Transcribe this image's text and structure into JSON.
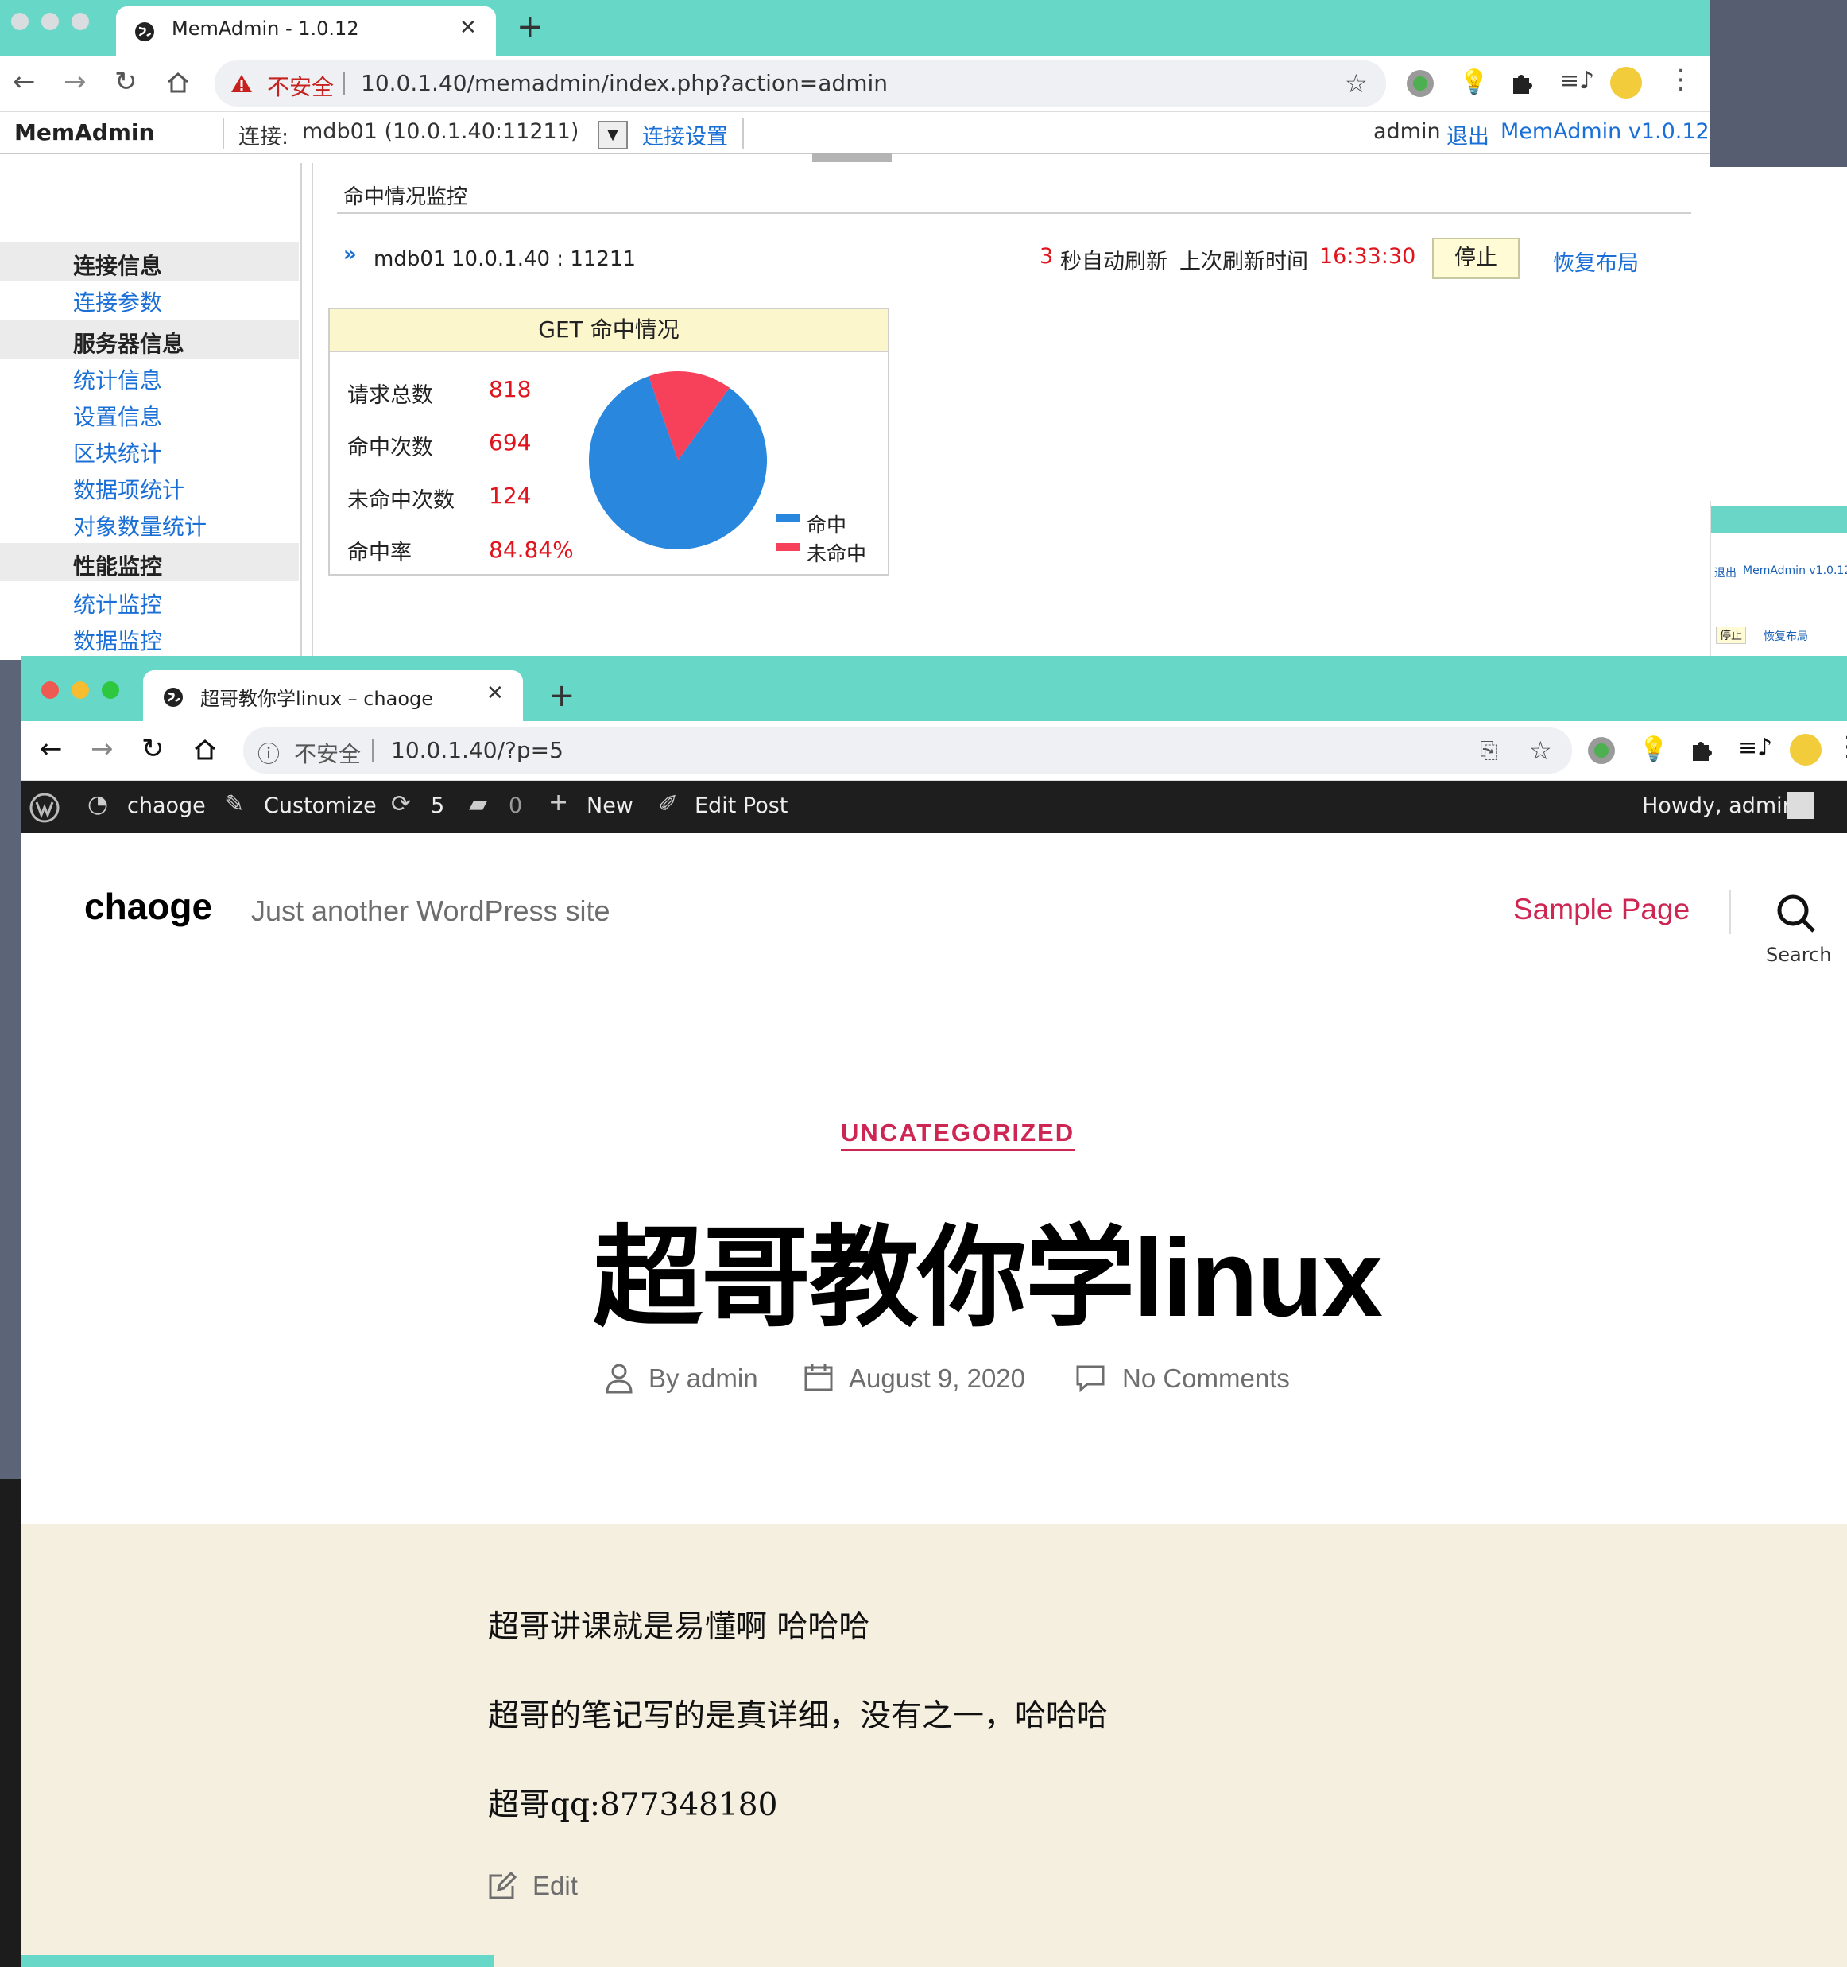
{
  "window1": {
    "tab_title": "MemAdmin - 1.0.12",
    "security_label": "不安全",
    "url": "10.0.1.40/memadmin/index.php?action=admin",
    "app": {
      "logo": "MemAdmin",
      "connect_label": "连接:",
      "connection_value": "mdb01 (10.0.1.40:11211)",
      "connect_settings": "连接设置",
      "user": "admin",
      "logout": "退出",
      "version": "MemAdmin v1.0.12"
    },
    "sidebar": {
      "sections": [
        {
          "header": "连接信息",
          "items": [
            "连接参数"
          ]
        },
        {
          "header": "服务器信息",
          "items": [
            "统计信息",
            "设置信息",
            "区块统计",
            "数据项统计",
            "对象数量统计"
          ]
        },
        {
          "header": "性能监控",
          "items": [
            "统计监控",
            "数据监控"
          ]
        }
      ]
    },
    "main": {
      "heading": "命中情况监控",
      "server_name": "mdb01",
      "server_addr": "10.0.1.40 : 11211",
      "refresh_seconds": "3",
      "refresh_label": "秒自动刷新",
      "last_refresh_label": "上次刷新时间",
      "last_refresh_time": "16:33:30",
      "stop_button": "停止",
      "restore_layout": "恢复布局",
      "get_box": {
        "title": "GET 命中情况",
        "rows": [
          {
            "label": "请求总数",
            "value": "818"
          },
          {
            "label": "命中次数",
            "value": "694"
          },
          {
            "label": "未命中次数",
            "value": "124"
          },
          {
            "label": "命中率",
            "value": "84.84%"
          }
        ],
        "legend": [
          {
            "name": "命中",
            "color": "#2a87de"
          },
          {
            "name": "未命中",
            "color": "#f7405a"
          }
        ]
      }
    }
  },
  "chart_data": {
    "type": "pie",
    "labels": [
      "命中",
      "未命中"
    ],
    "values": [
      694,
      124
    ],
    "colors": [
      "#2a87de",
      "#f7405a"
    ],
    "legend": "bottom-right"
  },
  "background_window": {
    "logout": "退出",
    "version": "MemAdmin v1.0.12",
    "stop_button": "停止",
    "restore_layout": "恢复布局"
  },
  "window2": {
    "tab_title": "超哥教你学linux – chaoge",
    "security_label": "不安全",
    "url": "10.0.1.40/?p=5",
    "admin_bar": {
      "site": "chaoge",
      "customize": "Customize",
      "updates": "5",
      "comments": "0",
      "new": "New",
      "edit_post": "Edit Post",
      "howdy": "Howdy, admin"
    },
    "header": {
      "site_title": "chaoge",
      "tagline": "Just another WordPress site",
      "nav_item": "Sample Page",
      "search_label": "Search"
    },
    "post": {
      "category": "UNCATEGORIZED",
      "title": "超哥教你学linux",
      "author": "By admin",
      "date": "August 9, 2020",
      "comments": "No Comments",
      "paragraphs": [
        "超哥讲课就是易懂啊 哈哈哈",
        "超哥的笔记写的是真详细，没有之一，哈哈哈",
        "超哥qq:877348180"
      ],
      "edit": "Edit"
    }
  },
  "colors": {
    "tab_bar": "#67d7c8",
    "link_blue": "#1a6fd6",
    "alert_red": "#e0141c",
    "wp_accent": "#cd2653",
    "content_bg": "#f5efe0",
    "admin_bar": "#1e1e1e"
  }
}
